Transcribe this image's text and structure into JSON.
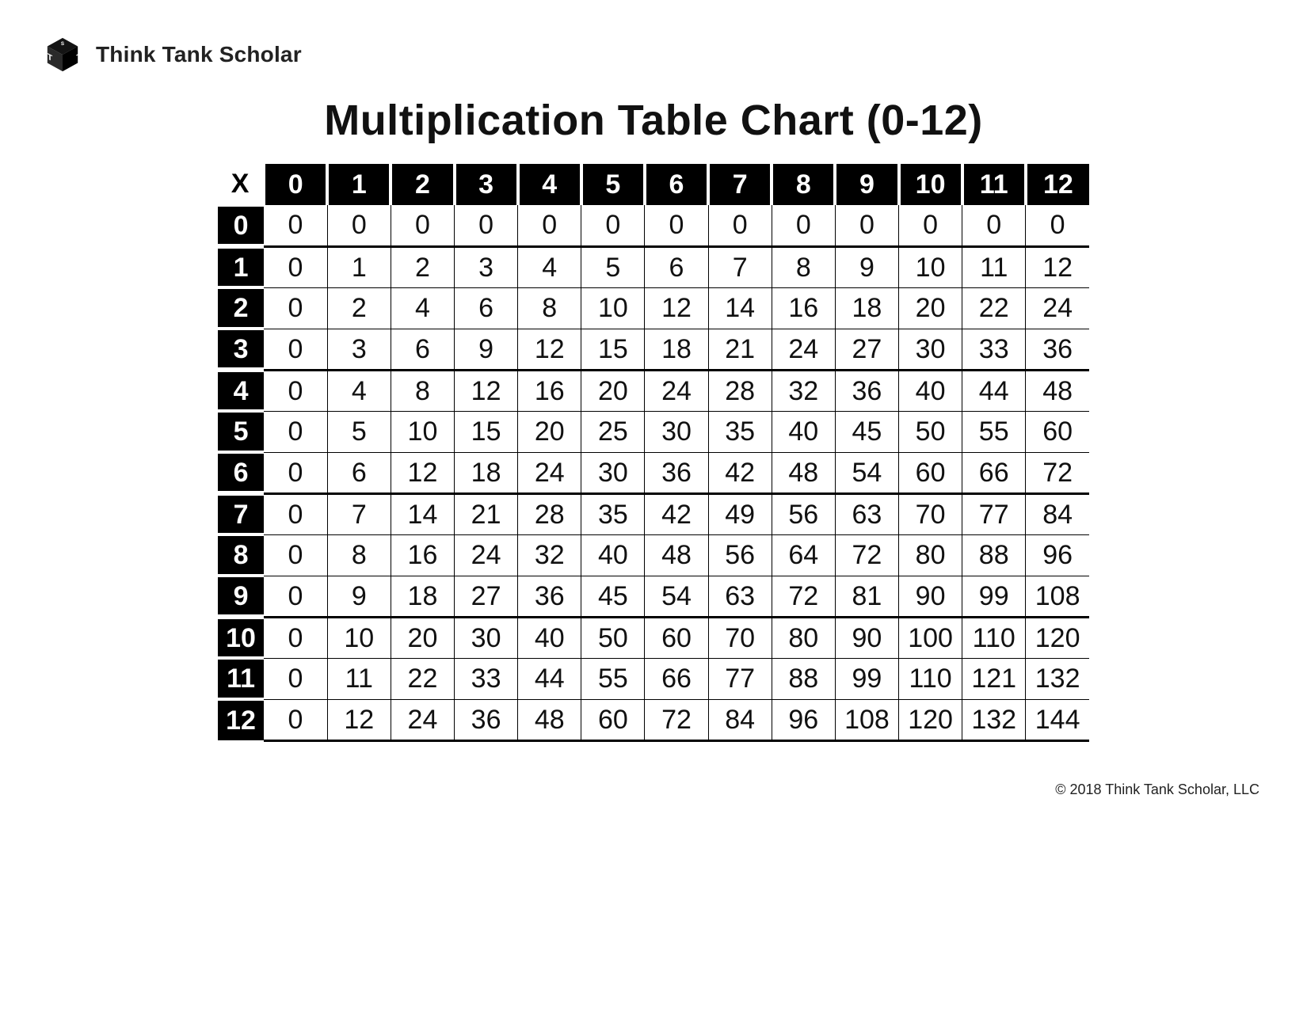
{
  "brand": {
    "name": "Think Tank Scholar"
  },
  "title": "Multiplication Table Chart (0-12)",
  "corner_label": "X",
  "columns": [
    "0",
    "1",
    "2",
    "3",
    "4",
    "5",
    "6",
    "7",
    "8",
    "9",
    "10",
    "11",
    "12"
  ],
  "rows": [
    {
      "label": "0",
      "cells": [
        "0",
        "0",
        "0",
        "0",
        "0",
        "0",
        "0",
        "0",
        "0",
        "0",
        "0",
        "0",
        "0"
      ]
    },
    {
      "label": "1",
      "cells": [
        "0",
        "1",
        "2",
        "3",
        "4",
        "5",
        "6",
        "7",
        "8",
        "9",
        "10",
        "11",
        "12"
      ]
    },
    {
      "label": "2",
      "cells": [
        "0",
        "2",
        "4",
        "6",
        "8",
        "10",
        "12",
        "14",
        "16",
        "18",
        "20",
        "22",
        "24"
      ]
    },
    {
      "label": "3",
      "cells": [
        "0",
        "3",
        "6",
        "9",
        "12",
        "15",
        "18",
        "21",
        "24",
        "27",
        "30",
        "33",
        "36"
      ]
    },
    {
      "label": "4",
      "cells": [
        "0",
        "4",
        "8",
        "12",
        "16",
        "20",
        "24",
        "28",
        "32",
        "36",
        "40",
        "44",
        "48"
      ]
    },
    {
      "label": "5",
      "cells": [
        "0",
        "5",
        "10",
        "15",
        "20",
        "25",
        "30",
        "35",
        "40",
        "45",
        "50",
        "55",
        "60"
      ]
    },
    {
      "label": "6",
      "cells": [
        "0",
        "6",
        "12",
        "18",
        "24",
        "30",
        "36",
        "42",
        "48",
        "54",
        "60",
        "66",
        "72"
      ]
    },
    {
      "label": "7",
      "cells": [
        "0",
        "7",
        "14",
        "21",
        "28",
        "35",
        "42",
        "49",
        "56",
        "63",
        "70",
        "77",
        "84"
      ]
    },
    {
      "label": "8",
      "cells": [
        "0",
        "8",
        "16",
        "24",
        "32",
        "40",
        "48",
        "56",
        "64",
        "72",
        "80",
        "88",
        "96"
      ]
    },
    {
      "label": "9",
      "cells": [
        "0",
        "9",
        "18",
        "27",
        "36",
        "45",
        "54",
        "63",
        "72",
        "81",
        "90",
        "99",
        "108"
      ]
    },
    {
      "label": "10",
      "cells": [
        "0",
        "10",
        "20",
        "30",
        "40",
        "50",
        "60",
        "70",
        "80",
        "90",
        "100",
        "110",
        "120"
      ]
    },
    {
      "label": "11",
      "cells": [
        "0",
        "11",
        "22",
        "33",
        "44",
        "55",
        "66",
        "77",
        "88",
        "99",
        "110",
        "121",
        "132"
      ]
    },
    {
      "label": "12",
      "cells": [
        "0",
        "12",
        "24",
        "36",
        "48",
        "60",
        "72",
        "84",
        "96",
        "108",
        "120",
        "132",
        "144"
      ]
    }
  ],
  "footer": "© 2018 Think Tank Scholar, LLC",
  "chart_data": {
    "type": "table",
    "title": "Multiplication Table Chart (0-12)",
    "row_labels": [
      0,
      1,
      2,
      3,
      4,
      5,
      6,
      7,
      8,
      9,
      10,
      11,
      12
    ],
    "col_labels": [
      0,
      1,
      2,
      3,
      4,
      5,
      6,
      7,
      8,
      9,
      10,
      11,
      12
    ],
    "values": [
      [
        0,
        0,
        0,
        0,
        0,
        0,
        0,
        0,
        0,
        0,
        0,
        0,
        0
      ],
      [
        0,
        1,
        2,
        3,
        4,
        5,
        6,
        7,
        8,
        9,
        10,
        11,
        12
      ],
      [
        0,
        2,
        4,
        6,
        8,
        10,
        12,
        14,
        16,
        18,
        20,
        22,
        24
      ],
      [
        0,
        3,
        6,
        9,
        12,
        15,
        18,
        21,
        24,
        27,
        30,
        33,
        36
      ],
      [
        0,
        4,
        8,
        12,
        16,
        20,
        24,
        28,
        32,
        36,
        40,
        44,
        48
      ],
      [
        0,
        5,
        10,
        15,
        20,
        25,
        30,
        35,
        40,
        45,
        50,
        55,
        60
      ],
      [
        0,
        6,
        12,
        18,
        24,
        30,
        36,
        42,
        48,
        54,
        60,
        66,
        72
      ],
      [
        0,
        7,
        14,
        21,
        28,
        35,
        42,
        49,
        56,
        63,
        70,
        77,
        84
      ],
      [
        0,
        8,
        16,
        24,
        32,
        40,
        48,
        56,
        64,
        72,
        80,
        88,
        96
      ],
      [
        0,
        9,
        18,
        27,
        36,
        45,
        54,
        63,
        72,
        81,
        90,
        99,
        108
      ],
      [
        0,
        10,
        20,
        30,
        40,
        50,
        60,
        70,
        80,
        90,
        100,
        110,
        120
      ],
      [
        0,
        11,
        22,
        33,
        44,
        55,
        66,
        77,
        88,
        99,
        110,
        121,
        132
      ],
      [
        0,
        12,
        24,
        36,
        48,
        60,
        72,
        84,
        96,
        108,
        120,
        132,
        144
      ]
    ]
  }
}
